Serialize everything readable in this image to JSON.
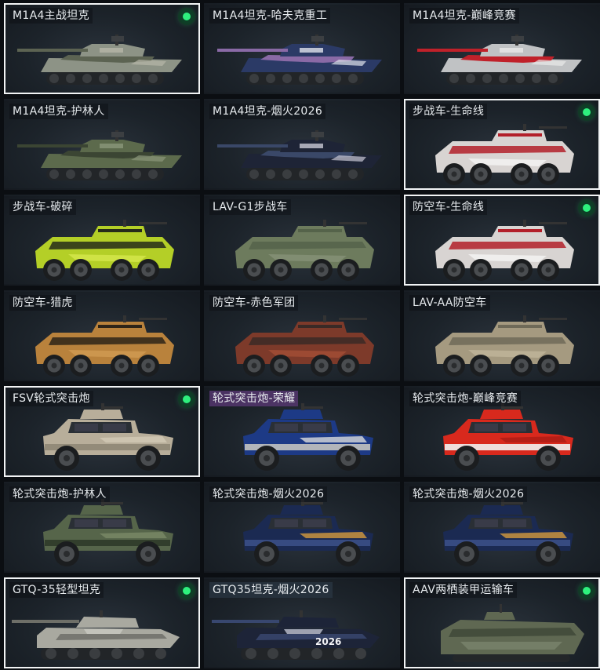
{
  "vehicles": [
    {
      "name": "M1A4主战坦克",
      "type": "tank",
      "camo": [
        "#8d9386",
        "#5c6352",
        "#b7b7a8"
      ],
      "owned": true,
      "selected": true
    },
    {
      "name": "M1A4坦克-哈夫克重工",
      "type": "tank",
      "camo": [
        "#2b3a66",
        "#8a6aa6",
        "#e1e4ec"
      ],
      "owned": false,
      "selected": false
    },
    {
      "name": "M1A4坦克-巅峰竞赛",
      "type": "tank",
      "camo": [
        "#c0c2c4",
        "#c0212a",
        "#e9e9e9"
      ],
      "owned": false,
      "selected": false
    },
    {
      "name": "M1A4坦克-护林人",
      "type": "tank",
      "camo": [
        "#5c6a4c",
        "#3b4533",
        "#8b977a"
      ],
      "owned": false,
      "selected": false
    },
    {
      "name": "M1A4坦克-烟火2026",
      "type": "tank",
      "camo": [
        "#1e2436",
        "#3a4868",
        "#c9c9d6"
      ],
      "owned": false,
      "selected": false
    },
    {
      "name": "步战车-生命线",
      "type": "ifv",
      "camo": [
        "#d8d4d2",
        "#b3202a",
        "#ffffff"
      ],
      "owned": true,
      "selected": true
    },
    {
      "name": "步战车-破碎",
      "type": "ifv",
      "camo": [
        "#b4cf27",
        "#262b1a",
        "#e1f05a"
      ],
      "owned": false,
      "selected": false
    },
    {
      "name": "LAV-G1步战车",
      "type": "ifv",
      "camo": [
        "#6d7b5d",
        "#55634a",
        "#8f9a80"
      ],
      "owned": false,
      "selected": false
    },
    {
      "name": "防空车-生命线",
      "type": "ifv",
      "camo": [
        "#d8d4d2",
        "#b3202a",
        "#ffffff"
      ],
      "owned": true,
      "selected": true
    },
    {
      "name": "防空车-猎虎",
      "type": "ifv",
      "camo": [
        "#b9823c",
        "#2d2418",
        "#d9a45a"
      ],
      "owned": false,
      "selected": false
    },
    {
      "name": "防空车-赤色军团",
      "type": "ifv",
      "camo": [
        "#7d3a2a",
        "#3a2a26",
        "#b0553b"
      ],
      "owned": false,
      "selected": false
    },
    {
      "name": "LAV-AA防空车",
      "type": "ifv",
      "camo": [
        "#a59a80",
        "#6f6a58",
        "#c9bfa4"
      ],
      "owned": false,
      "selected": false
    },
    {
      "name": "FSV轮式突击炮",
      "type": "jltv",
      "camo": [
        "#b8ae9a",
        "#8f8776",
        "#d4cbb7"
      ],
      "owned": true,
      "selected": true
    },
    {
      "name": "轮式突击炮-荣耀",
      "type": "jltv",
      "camo": [
        "#1d3a86",
        "#c3c3c0",
        "#e7e7e2"
      ],
      "owned": false,
      "selected": false,
      "tag": "purple"
    },
    {
      "name": "轮式突击炮-巅峰竞赛",
      "type": "jltv",
      "camo": [
        "#d8291d",
        "#f1f1f1",
        "#a91b14"
      ],
      "owned": false,
      "selected": false
    },
    {
      "name": "轮式突击炮-护林人",
      "type": "jltv",
      "camo": [
        "#56654a",
        "#2f3a29",
        "#7d8c6a"
      ],
      "owned": false,
      "selected": false
    },
    {
      "name": "轮式突击炮-烟火2026",
      "type": "jltv",
      "camo": [
        "#1b2a52",
        "#3b4f86",
        "#e2a23c"
      ],
      "owned": false,
      "selected": false
    },
    {
      "name": "轮式突击炮-烟火2026",
      "type": "jltv",
      "camo": [
        "#1b2a52",
        "#3b4f86",
        "#e2a23c"
      ],
      "owned": false,
      "selected": false
    },
    {
      "name": "GTQ-35轻型坦克",
      "type": "light",
      "camo": [
        "#a9a9a0",
        "#6e6f68",
        "#cfcfc6"
      ],
      "owned": true,
      "selected": true
    },
    {
      "name": "GTQ35坦克-烟火2026",
      "type": "light",
      "camo": [
        "#1d2438",
        "#38476f",
        "#d5d8e6"
      ],
      "owned": false,
      "selected": false,
      "tag": "dark",
      "badge": "2026"
    },
    {
      "name": "AAV两栖装甲运输车",
      "type": "aav",
      "camo": [
        "#5f6852",
        "#3d4637",
        "#8a937b"
      ],
      "owned": true,
      "selected": true
    }
  ]
}
